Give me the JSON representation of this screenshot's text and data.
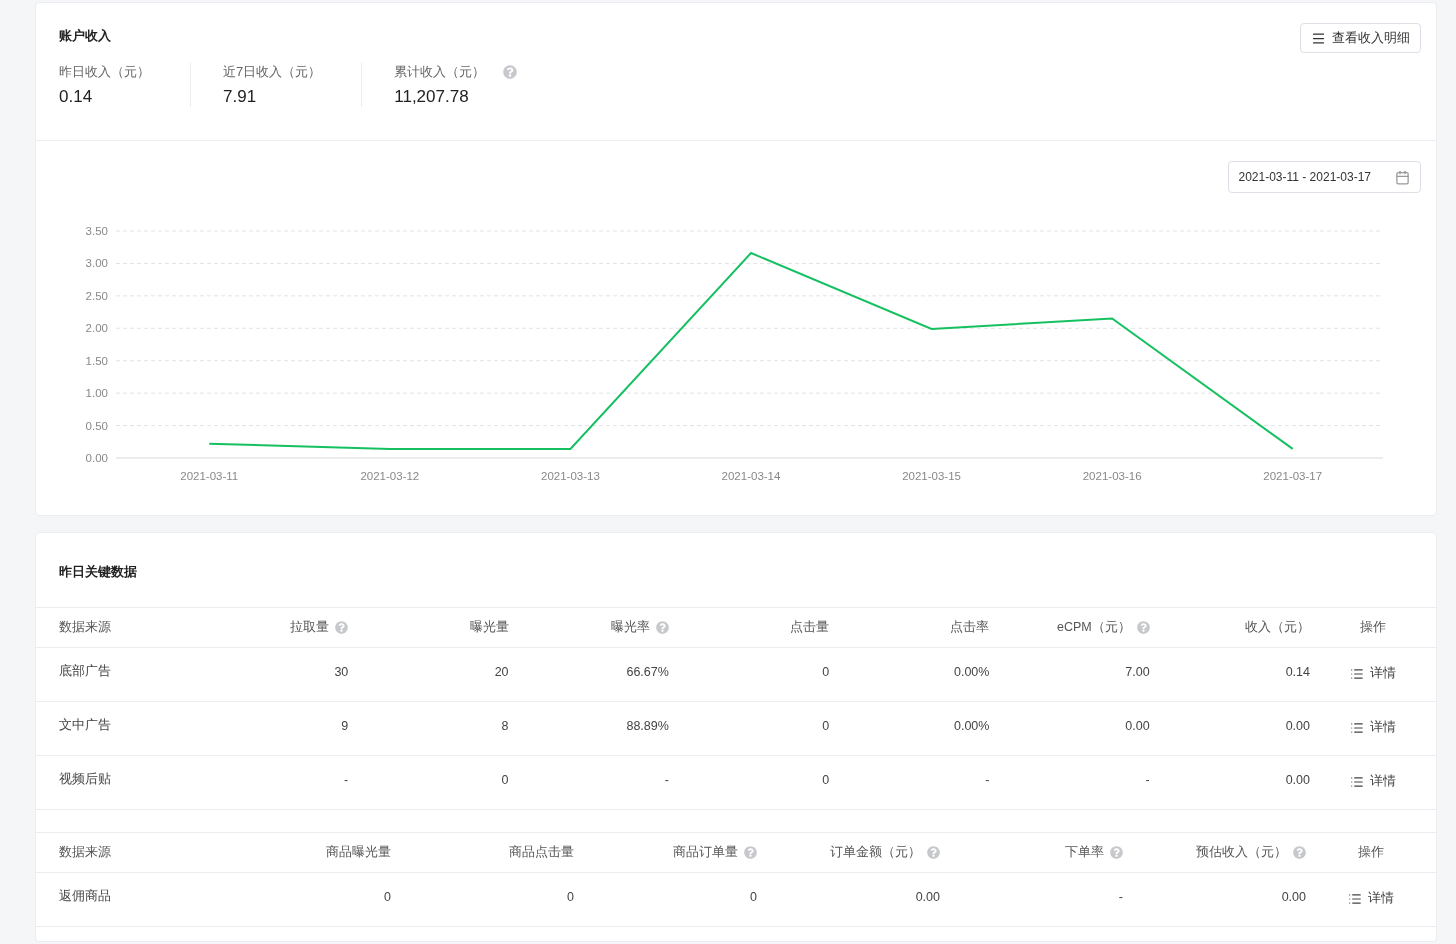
{
  "account_income": {
    "title": "账户收入",
    "detail_button": {
      "label": "查看收入明细"
    },
    "stats": [
      {
        "label": "昨日收入（元）",
        "value": "0.14",
        "help": false
      },
      {
        "label": "近7日收入（元）",
        "value": "7.91",
        "help": false
      },
      {
        "label": "累计收入（元）",
        "value": "11,207.78",
        "help": true
      }
    ],
    "date_range": {
      "value": "2021-03-11 - 2021-03-17"
    },
    "chart_data": {
      "type": "line",
      "categories": [
        "2021-03-11",
        "2021-03-12",
        "2021-03-13",
        "2021-03-14",
        "2021-03-15",
        "2021-03-16",
        "2021-03-17"
      ],
      "grid": true,
      "series": [
        {
          "color": "#16c060",
          "values": [
            0.22,
            0.14,
            0.14,
            3.16,
            1.99,
            2.15,
            0.14
          ]
        }
      ],
      "ylim": [
        0,
        3.5
      ],
      "yticks": [
        {
          "value": 0,
          "label": "0.00"
        },
        {
          "value": 0.5,
          "label": "0.50"
        },
        {
          "value": 1,
          "label": "1.00"
        },
        {
          "value": 1.5,
          "label": "1.50"
        },
        {
          "value": 2,
          "label": "2.00"
        },
        {
          "value": 2.5,
          "label": "2.50"
        },
        {
          "value": 3,
          "label": "3.00"
        },
        {
          "value": 3.5,
          "label": "3.50"
        }
      ]
    }
  },
  "key_data": {
    "title": "昨日关键数据",
    "tables": [
      {
        "columns": [
          {
            "label": "数据来源",
            "help": false
          },
          {
            "label": "拉取量",
            "help": true
          },
          {
            "label": "曝光量",
            "help": false
          },
          {
            "label": "曝光率",
            "help": true
          },
          {
            "label": "点击量",
            "help": false
          },
          {
            "label": "点击率",
            "help": false
          },
          {
            "label": "eCPM（元）",
            "help": true
          },
          {
            "label": "收入（元）",
            "help": false
          },
          {
            "label": "操作",
            "help": false
          }
        ],
        "rows": [
          {
            "cells": [
              "底部广告",
              "30",
              "20",
              "66.67%",
              "0",
              "0.00%",
              "7.00",
              "0.14"
            ],
            "action": "详情"
          },
          {
            "cells": [
              "文中广告",
              "9",
              "8",
              "88.89%",
              "0",
              "0.00%",
              "0.00",
              "0.00"
            ],
            "action": "详情"
          },
          {
            "cells": [
              "视频后贴",
              "-",
              "0",
              "-",
              "0",
              "-",
              "-",
              "0.00"
            ],
            "action": "详情"
          }
        ]
      },
      {
        "columns": [
          {
            "label": "数据来源",
            "help": false
          },
          {
            "label": "商品曝光量",
            "help": false
          },
          {
            "label": "商品点击量",
            "help": false
          },
          {
            "label": "商品订单量",
            "help": true
          },
          {
            "label": "订单金额（元）",
            "help": true
          },
          {
            "label": "下单率",
            "help": true
          },
          {
            "label": "预估收入（元）",
            "help": true
          },
          {
            "label": "操作",
            "help": false
          }
        ],
        "rows": [
          {
            "cells": [
              "返佣商品",
              "0",
              "0",
              "0",
              "0.00",
              "-",
              "0.00"
            ],
            "action": "详情"
          }
        ]
      }
    ]
  }
}
